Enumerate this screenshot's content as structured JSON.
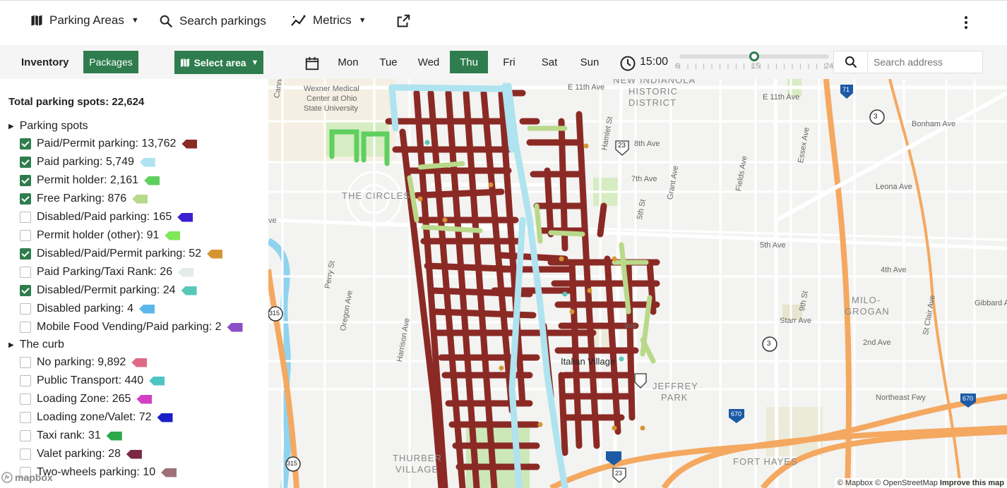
{
  "topbar": {
    "parking_areas": "Parking Areas",
    "search_parkings": "Search parkings",
    "metrics": "Metrics"
  },
  "toolbar": {
    "inventory": "Inventory",
    "packages": "Packages",
    "select_area": "Select area",
    "days": [
      "Mon",
      "Tue",
      "Wed",
      "Thu",
      "Fri",
      "Sat",
      "Sun"
    ],
    "active_day": "Thu",
    "time": "15:00",
    "slider": {
      "min_label": "6",
      "mid_label": "15",
      "max_label": "24",
      "value": 15
    },
    "search_placeholder": "Search address"
  },
  "sidebar": {
    "total": "Total parking spots: 22,624",
    "group1": "Parking spots",
    "items1": [
      {
        "label": "Paid/Permit parking: 13,762",
        "checked": true,
        "color": "#8b2a25"
      },
      {
        "label": "Paid parking: 5,749",
        "checked": true,
        "color": "#aee3ef"
      },
      {
        "label": "Permit holder: 2,161",
        "checked": true,
        "color": "#5fcf5f"
      },
      {
        "label": "Free Parking: 876",
        "checked": true,
        "color": "#b9d98a"
      },
      {
        "label": "Disabled/Paid parking: 165",
        "checked": false,
        "color": "#3a1fd0"
      },
      {
        "label": "Permit holder (other): 91",
        "checked": false,
        "color": "#7fe857"
      },
      {
        "label": "Disabled/Paid/Permit parking: 52",
        "checked": true,
        "color": "#d69533"
      },
      {
        "label": "Paid Parking/Taxi Rank: 26",
        "checked": false,
        "color": "#e3ece6"
      },
      {
        "label": "Disabled/Permit parking: 24",
        "checked": true,
        "color": "#58c8b8"
      },
      {
        "label": "Disabled parking: 4",
        "checked": false,
        "color": "#5ab8ea"
      },
      {
        "label": "Mobile Food Vending/Paid parking: 2",
        "checked": false,
        "color": "#8b4fc8"
      }
    ],
    "group2": "The curb",
    "items2": [
      {
        "label": "No parking: 9,892",
        "checked": false,
        "color": "#e06a86"
      },
      {
        "label": "Public Transport: 440",
        "checked": false,
        "color": "#4ec5c4"
      },
      {
        "label": "Loading Zone: 265",
        "checked": false,
        "color": "#d33fc4"
      },
      {
        "label": "Loading zone/Valet: 72",
        "checked": false,
        "color": "#1a1fc8"
      },
      {
        "label": "Taxi rank: 31",
        "checked": false,
        "color": "#2aa84a"
      },
      {
        "label": "Valet parking: 28",
        "checked": false,
        "color": "#7a2846"
      },
      {
        "label": "Two-wheels parking: 10",
        "checked": false,
        "color": "#a07078"
      }
    ]
  },
  "map": {
    "labels": [
      "Wexner Medical",
      "Center at Ohio",
      "State University",
      "E 11th Ave",
      "E 11th Ave",
      "8th Ave",
      "7th Ave",
      "Leona Ave",
      "Bonham Ave",
      "5th Ave",
      "4th Ave",
      "Gibbard A",
      "2nd Ave",
      "Starr Ave",
      "Northeast Fwy",
      "Cannon Dr",
      "Perry St",
      "Oregon Ave",
      "Harrison Ave",
      "Hamlet St",
      "5th St",
      "Grant Ave",
      "Fields Ave",
      "Essex Ave",
      "9th St",
      "St Clair Ave",
      "Italian Village",
      "ave",
      "ve"
    ],
    "areas": [
      "NEW INDIANOLA",
      "HISTORIC",
      "DISTRICT",
      "THE CIRCLES",
      "MILO-",
      "GROGAN",
      "JEFFREY",
      "PARK",
      "FORT HAYES",
      "THURBER",
      "VILLAGE"
    ],
    "shields": [
      "3",
      "3",
      "23",
      "71",
      "315",
      "315",
      "670",
      "670",
      "23"
    ],
    "logo": "mapbox",
    "attribution": "© Mapbox © OpenStreetMap",
    "improve": "Improve this map"
  }
}
